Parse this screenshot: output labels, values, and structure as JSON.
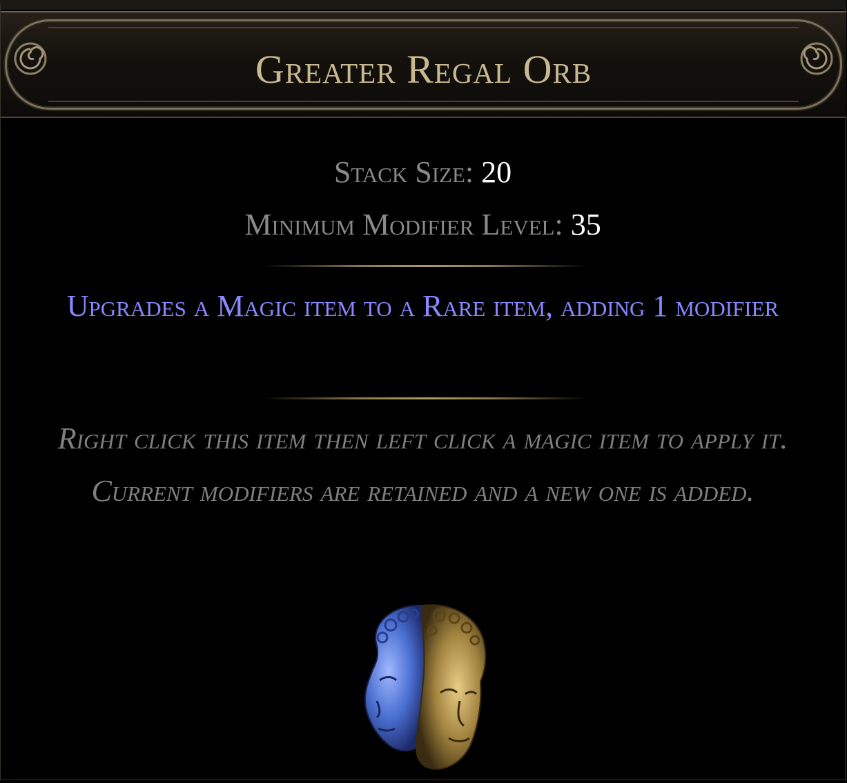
{
  "item": {
    "name": "Greater Regal Orb",
    "properties": [
      {
        "label": "Stack Size: ",
        "value": "20"
      },
      {
        "label": "Minimum Modifier Level: ",
        "value": "35"
      }
    ],
    "explicit_mod": "Upgrades a Magic item to a Rare item, adding 1 modifier",
    "description": "Right click this item then left click a magic item to apply it. Current modifiers are retained and a new one is added.",
    "icon": "regal-orb-two-faced-head-icon"
  },
  "colors": {
    "title": "#c9b991",
    "property_label": "#8a8a8a",
    "property_value": "#ffffff",
    "magic_mod": "#8888ff",
    "description": "#7f7f7f",
    "background": "#000000"
  }
}
